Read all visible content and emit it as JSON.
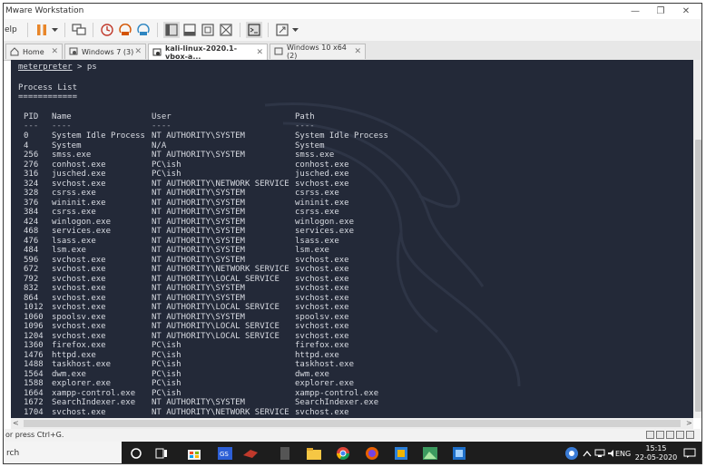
{
  "window": {
    "title": "Mware Workstation",
    "controls": {
      "minimize": "—",
      "restore": "❐",
      "close": "✕"
    }
  },
  "toolbar": {
    "help_label": "elp"
  },
  "tabs": [
    {
      "label": "Home",
      "icon": "home-icon",
      "active": false
    },
    {
      "label": "Windows 7 (3)",
      "icon": "vm-icon",
      "active": false
    },
    {
      "label": "kali-linux-2020.1-vbox-a...",
      "icon": "vm-icon",
      "active": true
    },
    {
      "label": "Windows 10 x64 (2)",
      "icon": "vm-icon",
      "active": false
    }
  ],
  "console": {
    "prompt": "meterpreter",
    "command": " > ps",
    "heading": "Process List",
    "heading_rule": "============",
    "columns": {
      "pid": "PID",
      "name": "Name",
      "user": "User",
      "path": "Path"
    },
    "underlines": {
      "pid": "---",
      "name": "----",
      "user": "----",
      "path": "----"
    },
    "rows": [
      {
        "pid": "0",
        "name": "System Idle Process",
        "user": "NT AUTHORITY\\SYSTEM",
        "path": "System Idle Process"
      },
      {
        "pid": "4",
        "name": "System",
        "user": "N/A",
        "path": "System"
      },
      {
        "pid": "256",
        "name": "smss.exe",
        "user": "NT AUTHORITY\\SYSTEM",
        "path": "smss.exe"
      },
      {
        "pid": "276",
        "name": "conhost.exe",
        "user": "PC\\ish",
        "path": "conhost.exe"
      },
      {
        "pid": "316",
        "name": "jusched.exe",
        "user": "PC\\ish",
        "path": "jusched.exe"
      },
      {
        "pid": "324",
        "name": "svchost.exe",
        "user": "NT AUTHORITY\\NETWORK SERVICE",
        "path": "svchost.exe"
      },
      {
        "pid": "328",
        "name": "csrss.exe",
        "user": "NT AUTHORITY\\SYSTEM",
        "path": "csrss.exe"
      },
      {
        "pid": "376",
        "name": "wininit.exe",
        "user": "NT AUTHORITY\\SYSTEM",
        "path": "wininit.exe"
      },
      {
        "pid": "384",
        "name": "csrss.exe",
        "user": "NT AUTHORITY\\SYSTEM",
        "path": "csrss.exe"
      },
      {
        "pid": "424",
        "name": "winlogon.exe",
        "user": "NT AUTHORITY\\SYSTEM",
        "path": "winlogon.exe"
      },
      {
        "pid": "468",
        "name": "services.exe",
        "user": "NT AUTHORITY\\SYSTEM",
        "path": "services.exe"
      },
      {
        "pid": "476",
        "name": "lsass.exe",
        "user": "NT AUTHORITY\\SYSTEM",
        "path": "lsass.exe"
      },
      {
        "pid": "484",
        "name": "lsm.exe",
        "user": "NT AUTHORITY\\SYSTEM",
        "path": "lsm.exe"
      },
      {
        "pid": "596",
        "name": "svchost.exe",
        "user": "NT AUTHORITY\\SYSTEM",
        "path": "svchost.exe"
      },
      {
        "pid": "672",
        "name": "svchost.exe",
        "user": "NT AUTHORITY\\NETWORK SERVICE",
        "path": "svchost.exe"
      },
      {
        "pid": "792",
        "name": "svchost.exe",
        "user": "NT AUTHORITY\\LOCAL SERVICE",
        "path": "svchost.exe"
      },
      {
        "pid": "832",
        "name": "svchost.exe",
        "user": "NT AUTHORITY\\SYSTEM",
        "path": "svchost.exe"
      },
      {
        "pid": "864",
        "name": "svchost.exe",
        "user": "NT AUTHORITY\\SYSTEM",
        "path": "svchost.exe"
      },
      {
        "pid": "1012",
        "name": "svchost.exe",
        "user": "NT AUTHORITY\\LOCAL SERVICE",
        "path": "svchost.exe"
      },
      {
        "pid": "1060",
        "name": "spoolsv.exe",
        "user": "NT AUTHORITY\\SYSTEM",
        "path": "spoolsv.exe"
      },
      {
        "pid": "1096",
        "name": "svchost.exe",
        "user": "NT AUTHORITY\\LOCAL SERVICE",
        "path": "svchost.exe"
      },
      {
        "pid": "1204",
        "name": "svchost.exe",
        "user": "NT AUTHORITY\\LOCAL SERVICE",
        "path": "svchost.exe"
      },
      {
        "pid": "1360",
        "name": "firefox.exe",
        "user": "PC\\ish",
        "path": "firefox.exe"
      },
      {
        "pid": "1476",
        "name": "httpd.exe",
        "user": "PC\\ish",
        "path": "httpd.exe"
      },
      {
        "pid": "1488",
        "name": "taskhost.exe",
        "user": "PC\\ish",
        "path": "taskhost.exe"
      },
      {
        "pid": "1564",
        "name": "dwm.exe",
        "user": "PC\\ish",
        "path": "dwm.exe"
      },
      {
        "pid": "1588",
        "name": "explorer.exe",
        "user": "PC\\ish",
        "path": "explorer.exe"
      },
      {
        "pid": "1664",
        "name": "xampp-control.exe",
        "user": "PC\\ish",
        "path": "xampp-control.exe"
      },
      {
        "pid": "1672",
        "name": "SearchIndexer.exe",
        "user": "NT AUTHORITY\\SYSTEM",
        "path": "SearchIndexer.exe"
      },
      {
        "pid": "1704",
        "name": "svchost.exe",
        "user": "NT AUTHORITY\\NETWORK SERVICE",
        "path": "svchost.exe"
      }
    ]
  },
  "statusbar": {
    "hint": "or press Ctrl+G."
  },
  "taskbar": {
    "search_text": "rch",
    "lang": "ENG",
    "time": "15:15",
    "date": "22-05-2020"
  },
  "colors": {
    "console_bg": "#232938",
    "console_fg": "#d8dbe2",
    "taskbar_bg": "#1d1d1d",
    "pause_orange": "#e8862a"
  }
}
